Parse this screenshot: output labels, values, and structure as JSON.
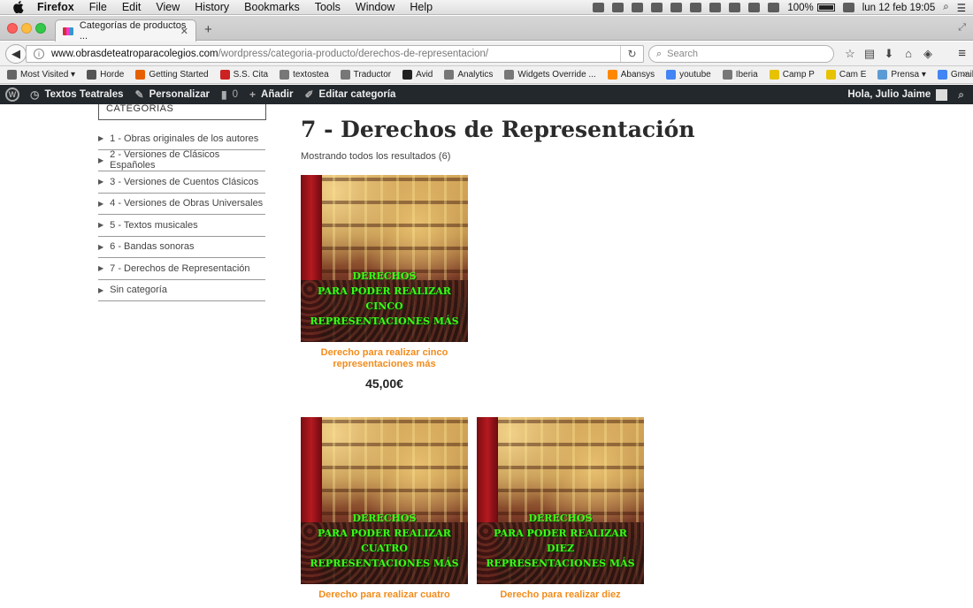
{
  "menubar": {
    "items": [
      "Firefox",
      "File",
      "Edit",
      "View",
      "History",
      "Bookmarks",
      "Tools",
      "Window",
      "Help"
    ],
    "battery": "100%",
    "datetime": "lun 12 feb  19:05"
  },
  "browser": {
    "tab_title": "Categorías de productos ...",
    "url_domain": "www.obrasdeteatroparacolegios.com",
    "url_path": "/wordpress/categoria-producto/derechos-de-representacion/",
    "search_placeholder": "Search"
  },
  "bookmarks": [
    {
      "label": "Most Visited ▾",
      "color": "#666666"
    },
    {
      "label": "Horde",
      "color": "#555555"
    },
    {
      "label": "Getting Started",
      "color": "#e66000"
    },
    {
      "label": "S.S. Cita",
      "color": "#cc2222"
    },
    {
      "label": "textostea",
      "color": "#777777"
    },
    {
      "label": "Traductor",
      "color": "#777777"
    },
    {
      "label": "Avid",
      "color": "#222222"
    },
    {
      "label": "Analytics",
      "color": "#777777"
    },
    {
      "label": "Widgets Override ...",
      "color": "#777777"
    },
    {
      "label": "Abansys",
      "color": "#ff8800"
    },
    {
      "label": "youtube",
      "color": "#4285f4"
    },
    {
      "label": "Iberia",
      "color": "#777777"
    },
    {
      "label": "Camp P",
      "color": "#e6c200"
    },
    {
      "label": "Cam E",
      "color": "#e6c200"
    },
    {
      "label": "Prensa ▾",
      "color": "#5b9bd5"
    },
    {
      "label": "Gmail",
      "color": "#4285f4"
    }
  ],
  "wpbar": {
    "site": "Textos Teatrales",
    "customize": "Personalizar",
    "comments": "0",
    "add_new": "Añadir",
    "edit": "Editar categoría",
    "greeting": "Hola, Julio Jaime"
  },
  "sidebar": {
    "header": "CATEGORÍAS",
    "items": [
      "1 - Obras originales de los autores",
      "2 - Versiones de Clásicos Españoles",
      "3 - Versiones de Cuentos Clásicos",
      "4 - Versiones de Obras Universales",
      "5 - Textos musicales",
      "6 - Bandas sonoras",
      "7 - Derechos de Representación",
      "Sin categoría"
    ]
  },
  "main": {
    "title": "7 - Derechos de Representación",
    "result_count": "Mostrando todos los resultados (6)",
    "products": [
      {
        "overlay": [
          "DERECHOS",
          "PARA PODER REALIZAR",
          "CINCO",
          "REPRESENTACIONES  MÁS"
        ],
        "name": "Derecho para realizar cinco representaciones más",
        "price": "45,00€"
      },
      {
        "overlay": [
          "DERECHOS",
          "PARA PODER REALIZAR",
          "CUATRO",
          "REPRESENTACIONES  MÁS"
        ],
        "name": "Derecho para realizar cuatro",
        "price": ""
      },
      {
        "overlay": [
          "DERECHOS",
          "PARA PODER REALIZAR",
          "DIEZ",
          "REPRESENTACIONES  MÁS"
        ],
        "name": "Derecho para realizar diez",
        "price": ""
      }
    ]
  }
}
